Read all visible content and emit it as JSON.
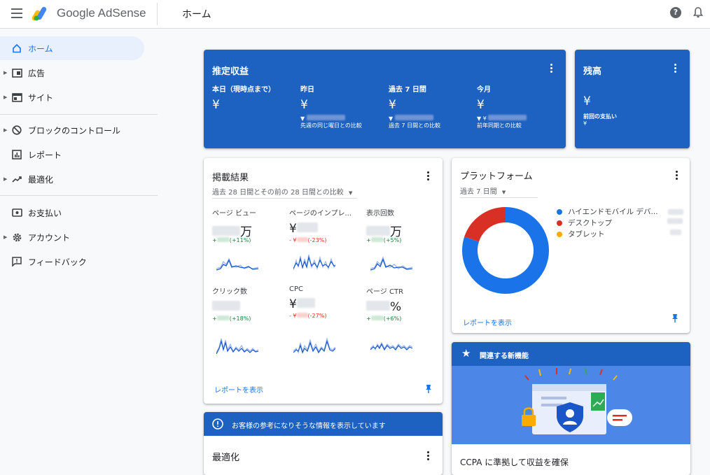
{
  "header": {
    "brand": "Google AdSense",
    "page_title": "ホーム",
    "help_glyph": "?"
  },
  "sidebar": {
    "items": [
      {
        "label": "ホーム"
      },
      {
        "label": "広告"
      },
      {
        "label": "サイト"
      },
      {
        "label": "ブロックのコントロール"
      },
      {
        "label": "レポート"
      },
      {
        "label": "最適化"
      },
      {
        "label": "お支払い"
      },
      {
        "label": "アカウント"
      },
      {
        "label": "フィードバック"
      }
    ]
  },
  "estimated": {
    "title": "推定収益",
    "columns": [
      {
        "label": "本日（現時点まで）",
        "value": "¥",
        "arrow": "",
        "compare": ""
      },
      {
        "label": "昨日",
        "value": "¥",
        "arrow": "▼",
        "compare": "先週の同じ曜日との比較"
      },
      {
        "label": "過去 7 日間",
        "value": "¥",
        "arrow": "▼",
        "compare": "過去 7 日間との比較"
      },
      {
        "label": "今月",
        "value": "¥",
        "arrow": "▼ ¥",
        "compare": "前年同期との比較"
      }
    ]
  },
  "balance": {
    "title": "残高",
    "value": "¥",
    "last_payment_label": "前回の支払い",
    "last_payment_value": "¥"
  },
  "performance": {
    "title": "掲載結果",
    "range": "過去 28 日間とその前の 28 日間との比較",
    "metrics": [
      {
        "label": "ページ ビュー",
        "prefix": "",
        "suffix": "万",
        "delta_sign": "+",
        "delta": "(+11%)",
        "trend": "up"
      },
      {
        "label": "ページのインプレ...",
        "prefix": "¥",
        "suffix": "",
        "delta_sign": "- ¥",
        "delta": "(-23%)",
        "trend": "down"
      },
      {
        "label": "表示回数",
        "prefix": "",
        "suffix": "万",
        "delta_sign": "+",
        "delta": "(+5%)",
        "trend": "up"
      },
      {
        "label": "クリック数",
        "prefix": "",
        "suffix": "",
        "delta_sign": "+",
        "delta": "(+18%)",
        "trend": "up"
      },
      {
        "label": "CPC",
        "prefix": "¥",
        "suffix": "",
        "delta_sign": "- ¥",
        "delta": "(-27%)",
        "trend": "down"
      },
      {
        "label": "ページ CTR",
        "prefix": "",
        "suffix": "%",
        "delta_sign": "+",
        "delta": "(+6%)",
        "trend": "up"
      }
    ],
    "link": "レポートを表示"
  },
  "platform": {
    "title": "プラットフォーム",
    "range": "過去 7 日間",
    "legend": [
      {
        "label": "ハイエンドモバイル デバ...",
        "color": "#1a73e8"
      },
      {
        "label": "デスクトップ",
        "color": "#d93025"
      },
      {
        "label": "タブレット",
        "color": "#f9ab00"
      }
    ],
    "share": [
      0.8,
      0.2,
      0.0
    ],
    "link": "レポートを表示"
  },
  "info_banner": {
    "text": "お客様の参考になりそうな情報を表示しています"
  },
  "optimization": {
    "title": "最適化"
  },
  "new_feature": {
    "header": "関連する新機能",
    "headline": "CCPA に準拠して収益を確保"
  },
  "colors": {
    "brand_blue": "#1e62c1",
    "accent": "#1a73e8",
    "positive": "#188038",
    "negative": "#d93025"
  }
}
